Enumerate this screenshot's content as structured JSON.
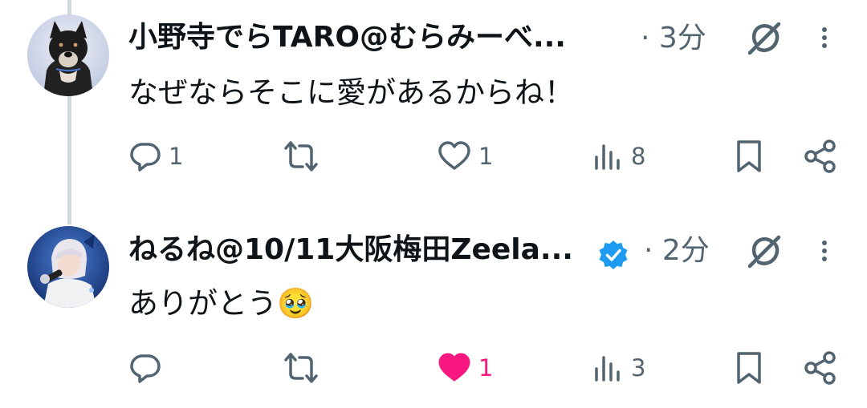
{
  "posts": [
    {
      "display_name": "小野寺でらTARO@むらみーべ...",
      "time": "· 3分",
      "text": "なぜならそこに愛があるからね！",
      "verified": false,
      "avatar": "dog-avatar",
      "actions": {
        "replies": "1",
        "reposts": "",
        "likes": "1",
        "liked": false,
        "views": "8"
      }
    },
    {
      "display_name": "ねるね@10/11大阪梅田Zeela...",
      "time": "· 2分",
      "text": "ありがとう🥹",
      "verified": true,
      "avatar": "singer-avatar",
      "actions": {
        "replies": "",
        "reposts": "",
        "likes": "1",
        "liked": true,
        "views": "3"
      }
    }
  ],
  "colors": {
    "text": "#0f1419",
    "secondary": "#536471",
    "like_active": "#f91880",
    "verified": "#1d9bf0",
    "thread_line": "#cfd9de"
  }
}
